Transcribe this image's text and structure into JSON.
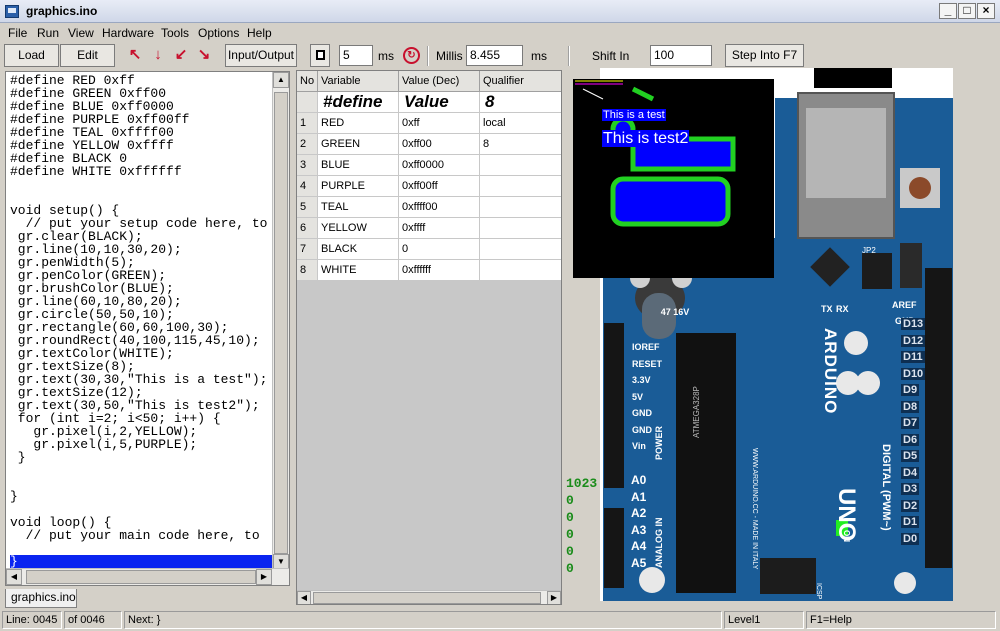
{
  "window": {
    "title": "graphics.ino",
    "minimize": "_",
    "maximize": "□",
    "close": "×"
  },
  "menu": [
    "File",
    "Run",
    "View",
    "Hardware",
    "Tools",
    "Options",
    "Help"
  ],
  "toolbar": {
    "load_label": "Load",
    "edit_label": "Edit",
    "io_label": "Input/Output",
    "step_ms_value": "5",
    "step_ms_unit": "ms",
    "millis_label": "Millis",
    "millis_value": "8.455",
    "millis_unit": "ms",
    "shift_in_label": "Shift In",
    "shift_in_value": "100",
    "step_into_label": "Step Into F7"
  },
  "editor": {
    "lines": [
      "#define RED 0xff",
      "#define GREEN 0xff00",
      "#define BLUE 0xff0000",
      "#define PURPLE 0xff00ff",
      "#define TEAL 0xffff00",
      "#define YELLOW 0xffff",
      "#define BLACK 0",
      "#define WHITE 0xffffff",
      "",
      "",
      "void setup() {",
      "  // put your setup code here, to",
      " gr.clear(BLACK);",
      " gr.line(10,10,30,20);",
      " gr.penWidth(5);",
      " gr.penColor(GREEN);",
      " gr.brushColor(BLUE);",
      " gr.line(60,10,80,20);",
      " gr.circle(50,50,10);",
      " gr.rectangle(60,60,100,30);",
      " gr.roundRect(40,100,115,45,10);",
      " gr.textColor(WHITE);",
      " gr.textSize(8);",
      " gr.text(30,30,\"This is a test\");",
      " gr.textSize(12);",
      " gr.text(30,50,\"This is test2\");",
      " for (int i=2; i<50; i++) {",
      "   gr.pixel(i,2,YELLOW);",
      "   gr.pixel(i,5,PURPLE);",
      " }",
      "",
      "",
      "}",
      "",
      "void loop() {",
      "  // put your main code here, to",
      "",
      "}"
    ],
    "tab_label": "graphics.ino"
  },
  "variables": {
    "headers": [
      "No",
      "Variable",
      "Value (Dec)",
      "Qualifier"
    ],
    "subheader": [
      "#define",
      "Value",
      "8"
    ],
    "rows": [
      [
        "1",
        "RED",
        "0xff",
        "local"
      ],
      [
        "2",
        "GREEN",
        "0xff00",
        "8"
      ],
      [
        "3",
        "BLUE",
        "0xff0000",
        ""
      ],
      [
        "4",
        "PURPLE",
        "0xff00ff",
        ""
      ],
      [
        "5",
        "TEAL",
        "0xffff00",
        ""
      ],
      [
        "6",
        "YELLOW",
        "0xffff",
        ""
      ],
      [
        "7",
        "BLACK",
        "0",
        ""
      ],
      [
        "8",
        "WHITE",
        "0xffffff",
        ""
      ]
    ]
  },
  "lcd": {
    "text1": "This is a test",
    "text2": "This is test2"
  },
  "board": {
    "left_pins": [
      "IOREF",
      "RESET",
      "3.3V",
      "5V",
      "GND",
      "GND",
      "Vin"
    ],
    "power_label": "POWER",
    "analog_label": "ANALOG IN",
    "analog_pins": [
      "A0",
      "A1",
      "A2",
      "A3",
      "A4",
      "A5"
    ],
    "analog_values": [
      "1023",
      "0",
      "0",
      "0",
      "0",
      "0"
    ],
    "digital_pins": [
      "D13",
      "D12",
      "D11",
      "D10",
      "D9",
      "D8",
      "D7",
      "D6",
      "D5",
      "D4",
      "D3",
      "D2",
      "D1",
      "D0"
    ],
    "aref": "AREF",
    "gnd": "GND",
    "brand": "ARDUINO",
    "model": "UNO",
    "digital_label": "DIGITAL (PWM~)",
    "url": "WWW.ARDUINO.CC - MADE IN ITALY",
    "chip_text": "ATMEGA328P",
    "cap_text": "47 16V",
    "on_label": "ON",
    "icsp": "ICSP",
    "tx": "TX",
    "rx": "RX",
    "jp2": "JP2"
  },
  "status": {
    "line": "Line: 0045",
    "of": "of 0046",
    "next": "Next: }",
    "level": "Level1",
    "help": "F1=Help"
  },
  "colors": {
    "selection": "#0a24f0",
    "board_blue": "#1a5c97",
    "lcd_green": "#22d022",
    "lcd_blue": "#0000ff",
    "pin_values": "#1a8c1a"
  }
}
